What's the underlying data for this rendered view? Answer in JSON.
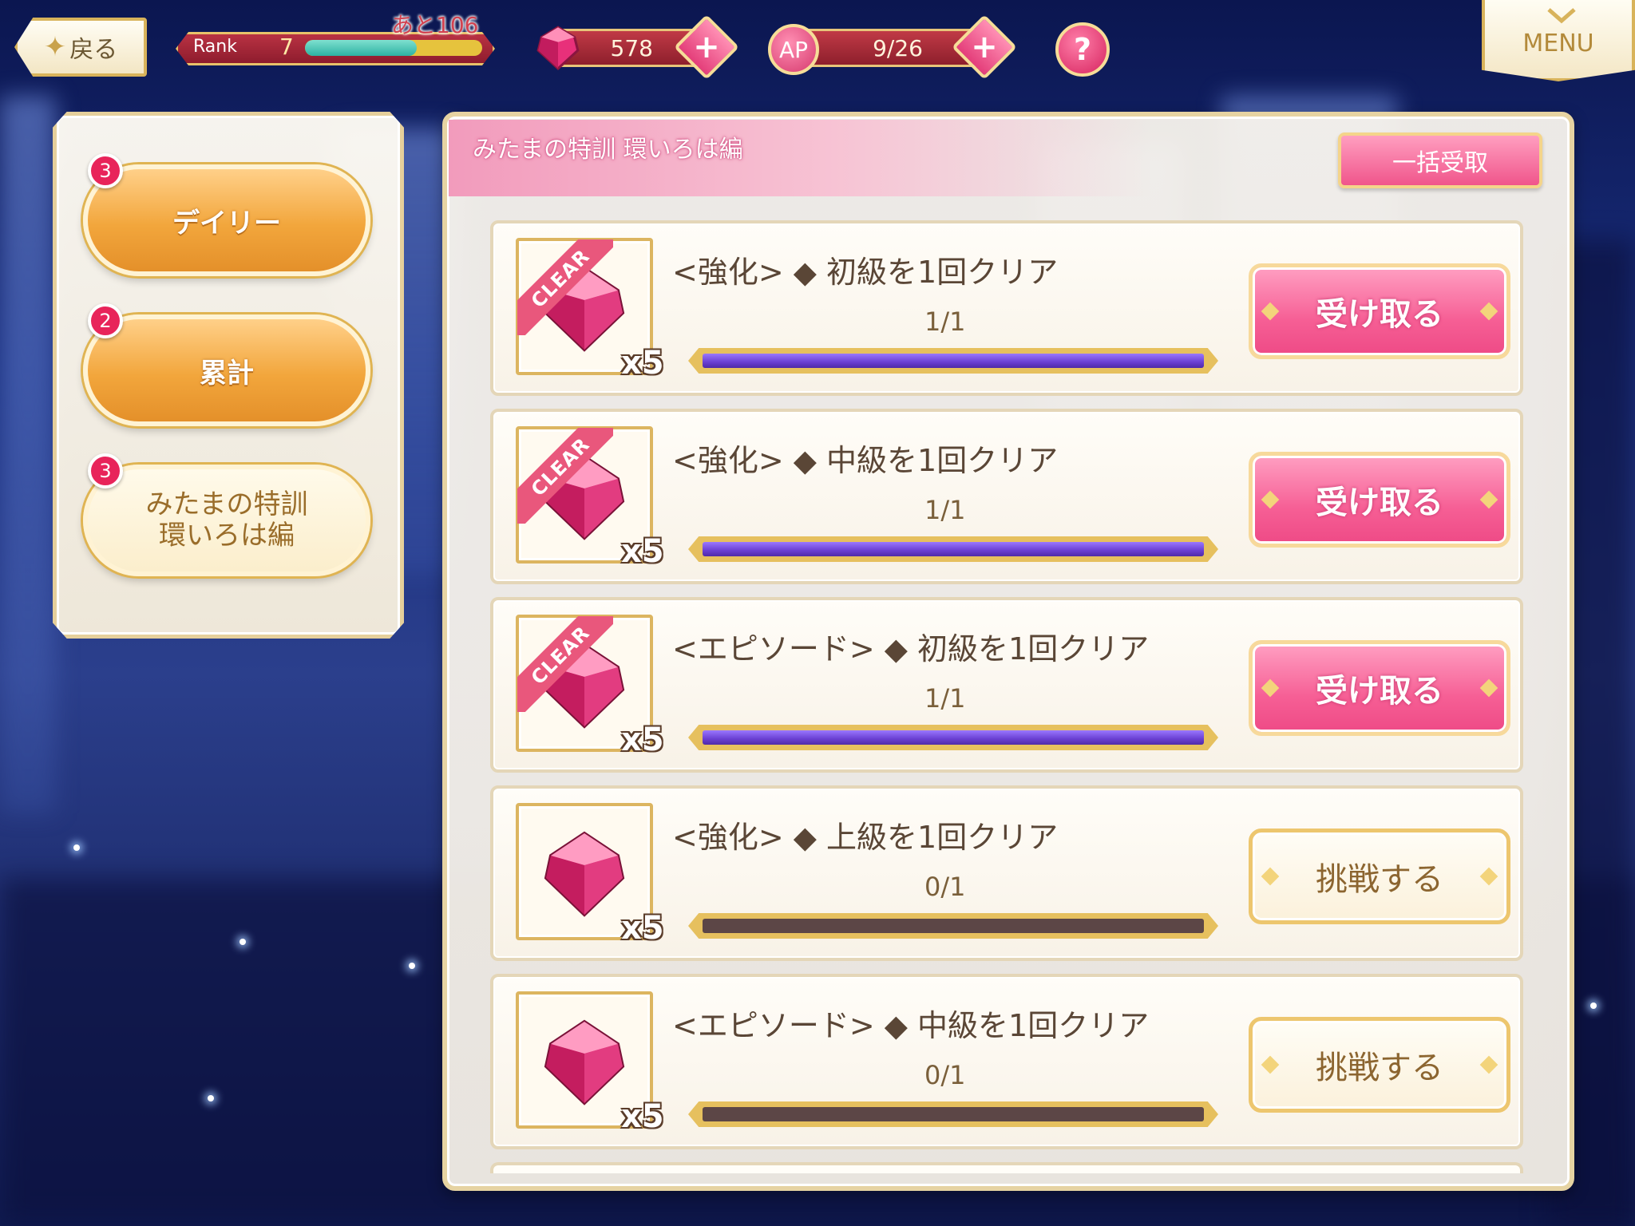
{
  "topbar": {
    "back_label": "戻る",
    "rank_label": "Rank",
    "rank_value": "7",
    "rank_remaining": "あと106",
    "rank_progress": 0.63,
    "gems_value": "578",
    "ap_label": "AP",
    "ap_value": "9/26",
    "help_label": "?",
    "menu_label": "MENU"
  },
  "tabs": [
    {
      "label": "デイリー",
      "badge": "3"
    },
    {
      "label": "累計",
      "badge": "2"
    },
    {
      "label_line1": "みたまの特訓",
      "label_line2": "環いろは編",
      "badge": "3"
    }
  ],
  "panel": {
    "title": "みたまの特訓 環いろは編",
    "bulk_claim_label": "一括受取"
  },
  "missions": [
    {
      "text": "<強化> ◆ 初級を1回クリア",
      "progress": "1/1",
      "fill": 1.0,
      "cleared": true,
      "clear_label": "CLEAR",
      "reward_qty": "x5",
      "action": "受け取る"
    },
    {
      "text": "<強化> ◆ 中級を1回クリア",
      "progress": "1/1",
      "fill": 1.0,
      "cleared": true,
      "clear_label": "CLEAR",
      "reward_qty": "x5",
      "action": "受け取る"
    },
    {
      "text": "<エピソード> ◆ 初級を1回クリア",
      "progress": "1/1",
      "fill": 1.0,
      "cleared": true,
      "clear_label": "CLEAR",
      "reward_qty": "x5",
      "action": "受け取る"
    },
    {
      "text": "<強化> ◆ 上級を1回クリア",
      "progress": "0/1",
      "fill": 0.0,
      "cleared": false,
      "reward_qty": "x5",
      "action": "挑戦する"
    },
    {
      "text": "<エピソード> ◆ 中級を1回クリア",
      "progress": "0/1",
      "fill": 0.0,
      "cleared": false,
      "reward_qty": "x5",
      "action": "挑戦する"
    }
  ],
  "colors": {
    "accent_pink": "#f65f95",
    "gold_border": "#dcb560",
    "progress_purple": "#6a3fd2",
    "badge_red": "#e8245a"
  },
  "icons": {
    "reward": "gem-icon",
    "back": "sparkle-icon",
    "menu": "chevron-down-icon",
    "help": "question-icon",
    "plus": "plus-icon"
  }
}
